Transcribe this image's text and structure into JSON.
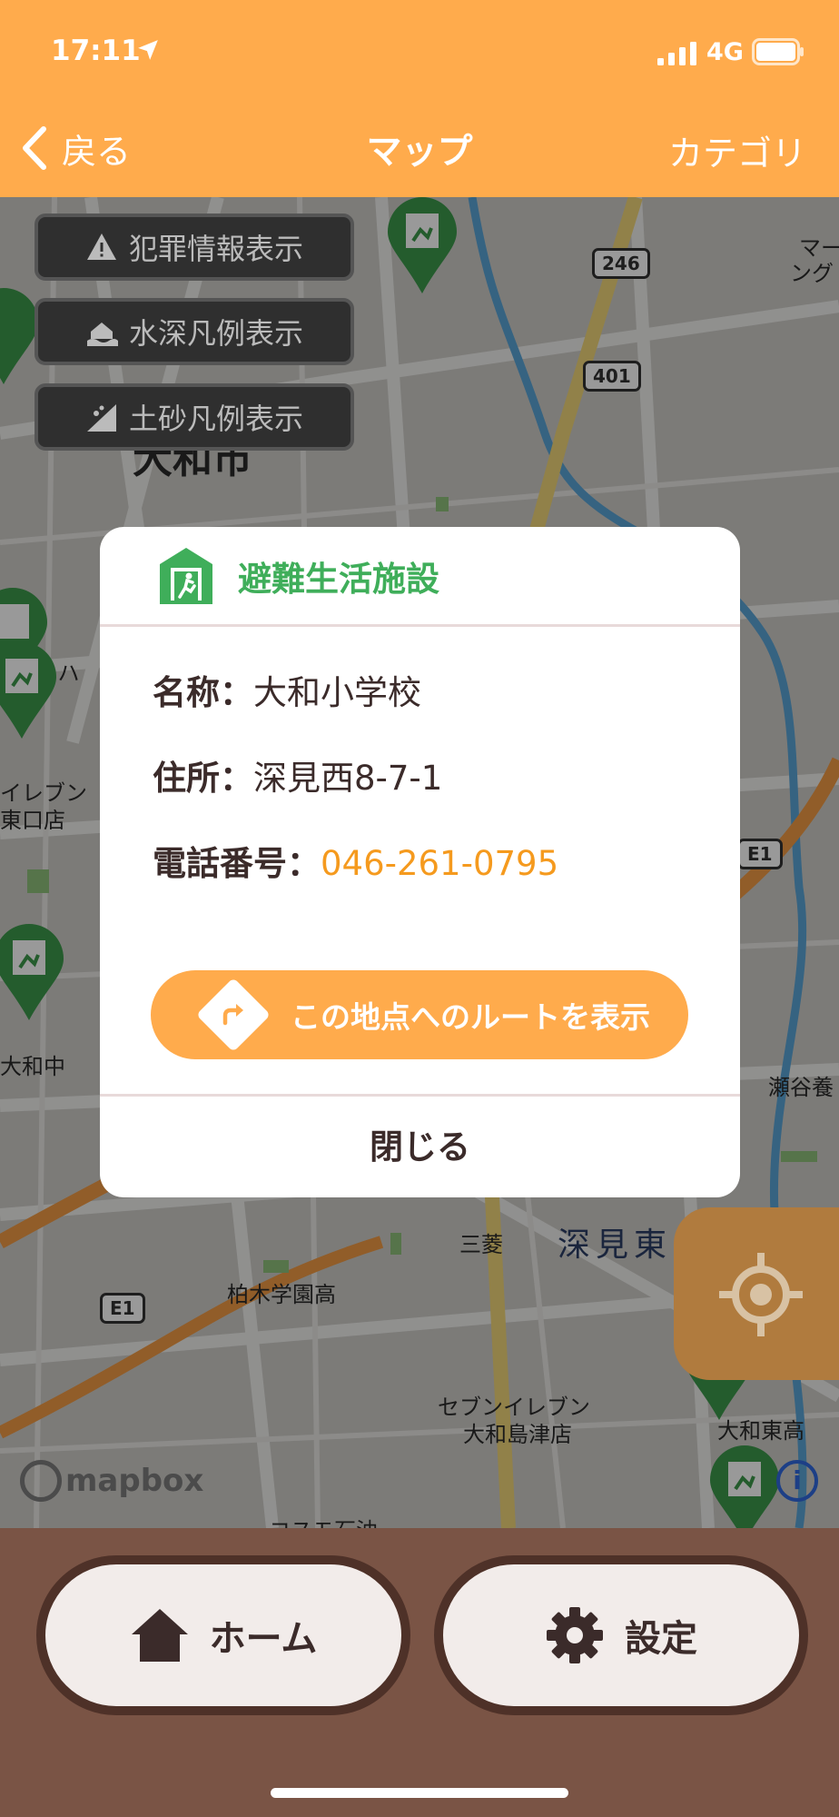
{
  "status_bar": {
    "time": "17:11",
    "network": "4G"
  },
  "nav": {
    "back_label": "戻る",
    "title": "マップ",
    "category_label": "カテゴリ"
  },
  "map": {
    "layer_buttons": [
      {
        "label": "犯罪情報表示",
        "icon": "warning-icon"
      },
      {
        "label": "水深凡例表示",
        "icon": "flood-icon"
      },
      {
        "label": "土砂凡例表示",
        "icon": "landslide-icon"
      }
    ],
    "place_labels": {
      "city": "大和市",
      "seven_eleven_1": "イレブン",
      "seven_eleven_2": "東口店",
      "yamato_middle": "大和中",
      "setagaya": "瀬谷養",
      "mitsubishi": "三菱",
      "fukami_east": "深見東",
      "kashiwagi": "柏木学園高",
      "seven_eleven_3a": "セブンイレブン",
      "seven_eleven_3b": "大和島津店",
      "yamato_east_high": "大和東高",
      "cosmo": "コスモ石油",
      "market_1": "マー",
      "market_2": "ング",
      "ha": "ーハ"
    },
    "road_shields": [
      "246",
      "401",
      "E1",
      "E1"
    ],
    "attribution": "mapbox",
    "info_label": "i",
    "pin_color": "#3d9a4c"
  },
  "modal": {
    "title": "避難生活施設",
    "title_color": "#3fae5a",
    "name_label": "名称：",
    "name_value": "大和小学校",
    "address_label": "住所：",
    "address_value": "深見西8-7-1",
    "phone_label": "電話番号：",
    "phone_value": "046-261-0795",
    "route_button": "この地点へのルートを表示",
    "close_button": "閉じる"
  },
  "bottom_nav": {
    "home_label": "ホーム",
    "settings_label": "設定"
  },
  "colors": {
    "accent": "#ffab4c",
    "bottom_bar": "#7a5445",
    "text_dark": "#3b2b2a",
    "phone_link": "#f59a1e"
  }
}
